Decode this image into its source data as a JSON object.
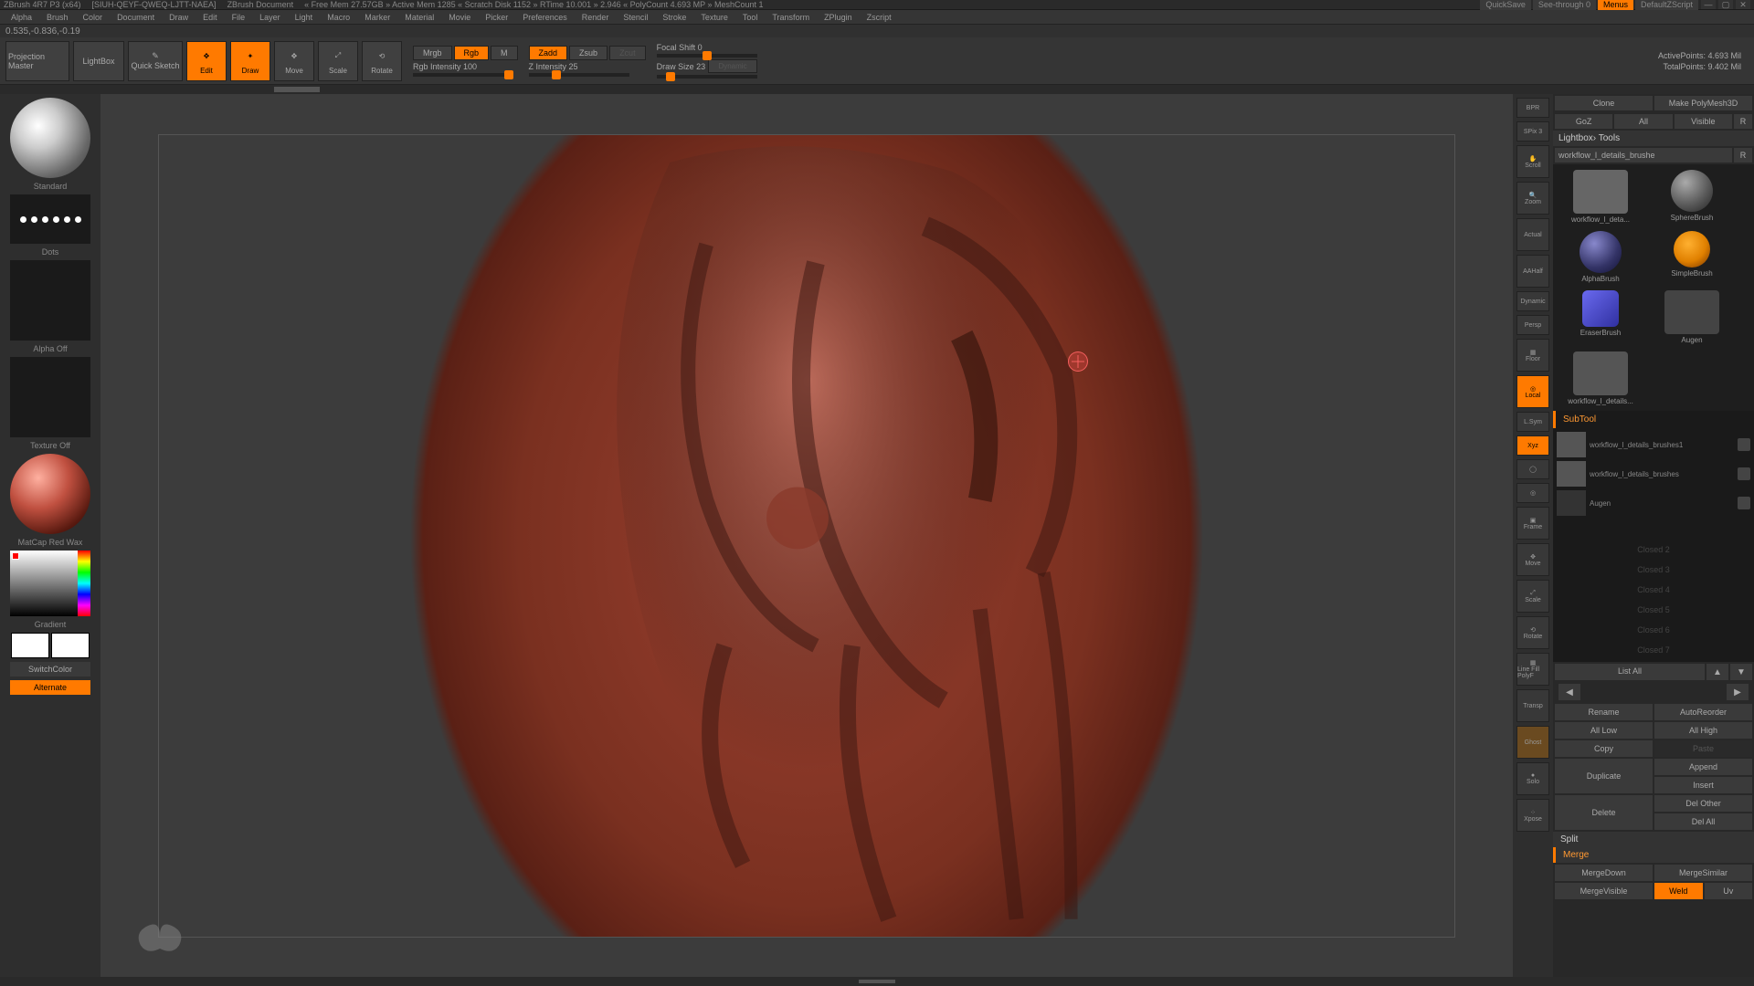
{
  "titlebar": {
    "app": "ZBrush 4R7 P3 (x64)",
    "file": "[SIUH-QEYF-QWEQ-LJTT-NAEA]",
    "doc": "ZBrush Document",
    "stats": "« Free Mem 27.57GB » Active Mem 1285 « Scratch Disk 1152 » RTime 10.001 » 2.946 « PolyCount 4.693 MP » MeshCount 1",
    "quicksave": "QuickSave",
    "seethrough": "See-through  0",
    "menus": "Menus",
    "script": "DefaultZScript"
  },
  "menubar": [
    "Alpha",
    "Brush",
    "Color",
    "Document",
    "Draw",
    "Edit",
    "File",
    "Layer",
    "Light",
    "Macro",
    "Marker",
    "Material",
    "Movie",
    "Picker",
    "Preferences",
    "Render",
    "Stencil",
    "Stroke",
    "Texture",
    "Tool",
    "Transform",
    "ZPlugin",
    "Zscript"
  ],
  "statusline": {
    "coords": "0.535,-0.836,-0.19"
  },
  "rp_top": {
    "goz": "GoZ",
    "all": "All",
    "visible": "Visible",
    "r": "R"
  },
  "toolbar": {
    "projection": "Projection Master",
    "lightbox": "LightBox",
    "quicksketch": "Quick Sketch",
    "edit": "Edit",
    "draw": "Draw",
    "move": "Move",
    "scale": "Scale",
    "rotate": "Rotate",
    "mrgb": "Mrgb",
    "rgb": "Rgb",
    "m": "M",
    "rgb_intensity": "Rgb Intensity 100",
    "zadd": "Zadd",
    "zsub": "Zsub",
    "zcut": "Zcut",
    "z_intensity": "Z Intensity 25",
    "focal": "Focal Shift 0",
    "drawsize": "Draw Size 23",
    "dynamic": "Dynamic",
    "active": "ActivePoints: 4.693 Mil",
    "total": "TotalPoints: 9.402 Mil"
  },
  "left": {
    "brush": "Standard",
    "stroke": "Dots",
    "alpha": "Alpha  Off",
    "texture": "Texture  Off",
    "material": "MatCap Red Wax",
    "gradient": "Gradient",
    "switch": "SwitchColor",
    "alternate": "Alternate"
  },
  "rightbar": {
    "bpr": "BPR",
    "spix": "SPix 3",
    "scroll": "Scroll",
    "zoom": "Zoom",
    "actual": "Actual",
    "aahalf": "AAHalf",
    "dynamic": "Dynamic",
    "persp": "Persp",
    "floor": "Floor",
    "local": "Local",
    "lsym": "L.Sym",
    "xyz": "Xyz",
    "frame": "Frame",
    "move": "Move",
    "scale": "Scale",
    "rotate": "Rotate",
    "polyf": "Line Fill PolyF",
    "transp": "Transp",
    "ghost": "Ghost",
    "solo": "Solo",
    "xpose": "Xpose"
  },
  "rp": {
    "clone": "Clone",
    "makepoly": "Make PolyMesh3D",
    "lightbox_tools": "Lightbox› Tools",
    "loadtool": "workflow_l_details_brushe",
    "r": "R",
    "tools": {
      "t1": "workflow_l_deta...",
      "t2": "SphereBrush",
      "t3": "AlphaBrush",
      "t4": "SimpleBrush",
      "t5": "EraserBrush",
      "t6": "Augen",
      "t7": "workflow_l_details..."
    },
    "subtool": "SubTool",
    "st1": "workflow_l_details_brushes1",
    "st2": "workflow_l_details_brushes",
    "st3": "Augen",
    "slot2": "Closed 2",
    "slot3": "Closed 3",
    "slot4": "Closed 4",
    "slot5": "Closed 5",
    "slot6": "Closed 6",
    "slot7": "Closed 7",
    "listall": "List All",
    "rename": "Rename",
    "autoreorder": "AutoReorder",
    "alllow": "All Low",
    "allhigh": "All High",
    "copy": "Copy",
    "paste": "Paste",
    "duplicate": "Duplicate",
    "append": "Append",
    "insert": "Insert",
    "delete": "Delete",
    "delother": "Del Other",
    "delall": "Del All",
    "split": "Split",
    "merge": "Merge",
    "mergedown": "MergeDown",
    "mergesimilar": "MergeSimilar",
    "mergevisible": "MergeVisible",
    "weld": "Weld",
    "uv": "Uv"
  }
}
